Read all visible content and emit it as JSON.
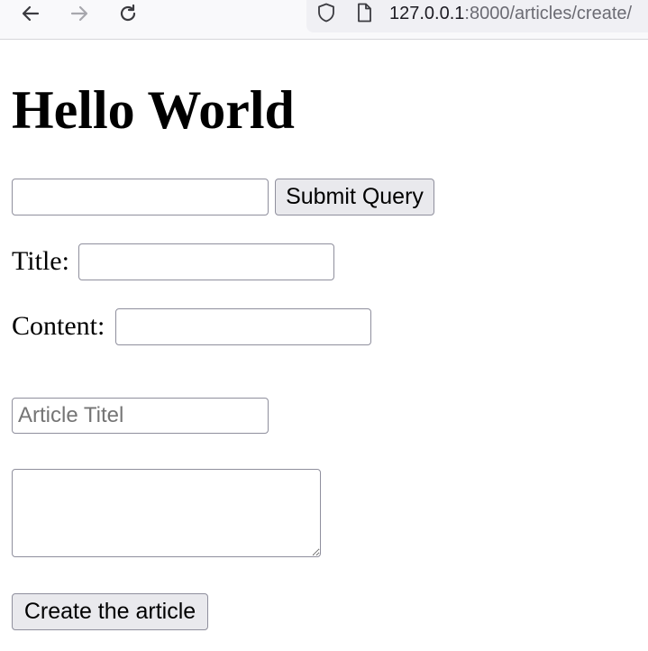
{
  "browser": {
    "back_icon": "arrow-left-icon",
    "forward_icon": "arrow-right-icon",
    "reload_icon": "reload-icon",
    "shield_icon": "shield-icon",
    "page_icon": "page-icon",
    "url_host": "127.0.0.1",
    "url_rest": ":8000/articles/create/"
  },
  "page": {
    "heading": "Hello World",
    "search_form": {
      "input_value": "",
      "submit_label": "Submit Query"
    },
    "title_label": "Title:",
    "title_value": "",
    "content_label": "Content:",
    "content_value": "",
    "article_form": {
      "title_placeholder": "Article Titel",
      "textarea_value": "",
      "create_label": "Create the article"
    }
  }
}
